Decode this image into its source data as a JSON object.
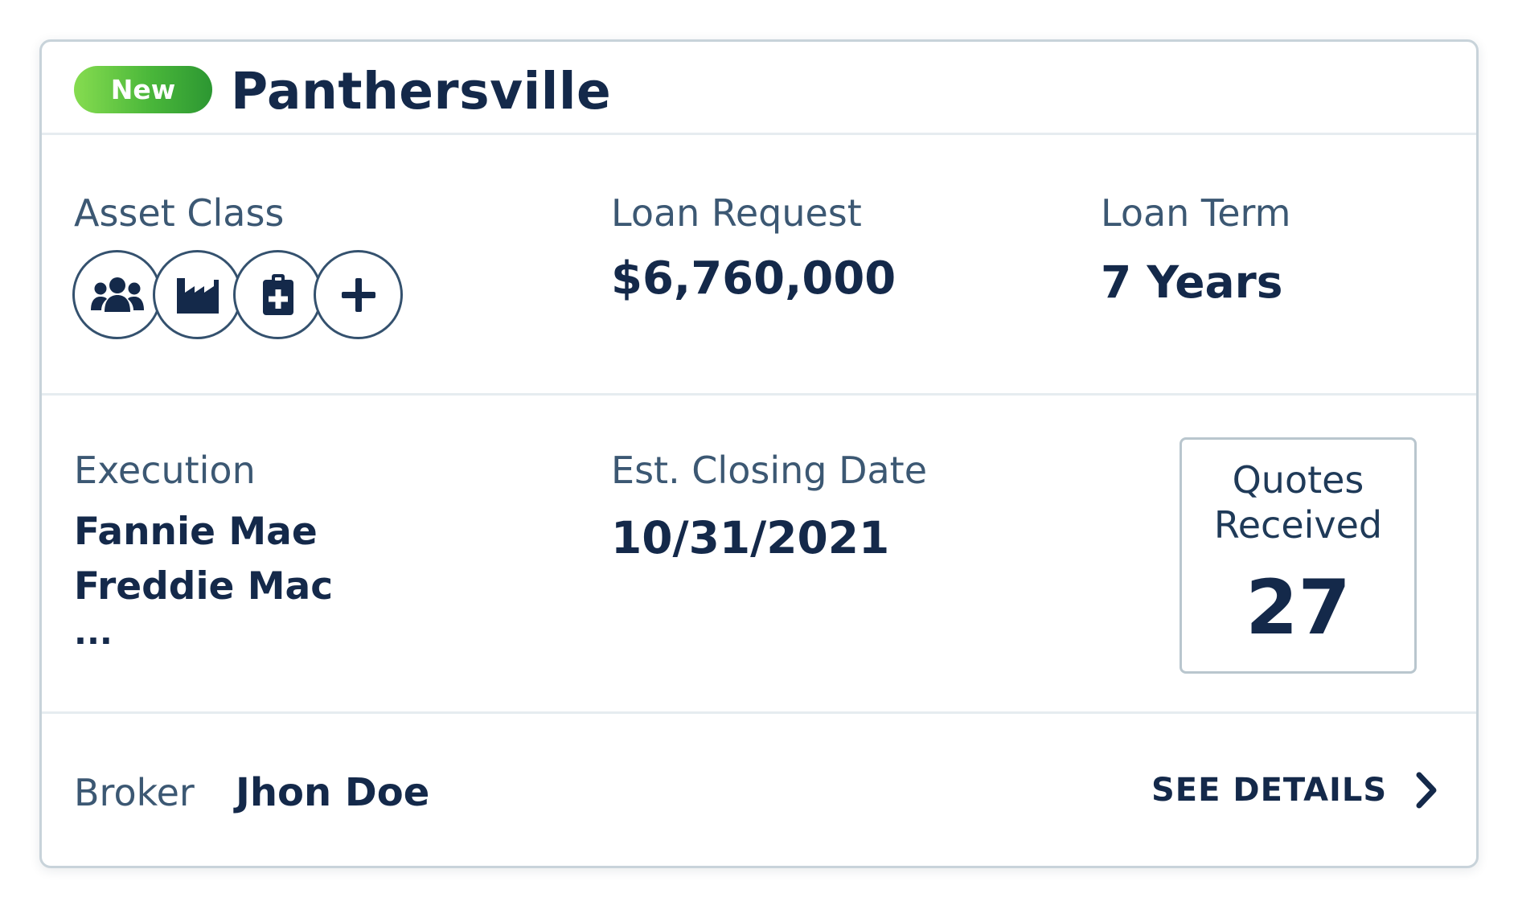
{
  "card": {
    "badge": "New",
    "title": "Panthersville",
    "asset_class": {
      "label": "Asset Class",
      "icons": [
        "group-icon",
        "factory-icon",
        "medical-clipboard-icon",
        "plus-icon"
      ]
    },
    "loan_request": {
      "label": "Loan Request",
      "value": "$6,760,000"
    },
    "loan_term": {
      "label": "Loan Term",
      "value": "7 Years"
    },
    "execution": {
      "label": "Execution",
      "lines": [
        "Fannie Mae",
        "Freddie Mac",
        "..."
      ]
    },
    "est_closing_date": {
      "label": "Est. Closing Date",
      "value": "10/31/2021"
    },
    "quotes": {
      "label_line1": "Quotes",
      "label_line2": "Received",
      "count": "27"
    },
    "broker": {
      "label": "Broker",
      "name": "Jhon Doe"
    },
    "see_details": "SEE DETAILS"
  },
  "colors": {
    "navy": "#14294a",
    "label": "#3c5873",
    "badge_green_start": "#86dc50",
    "badge_green_end": "#2c9732",
    "border": "#c8d3da"
  }
}
